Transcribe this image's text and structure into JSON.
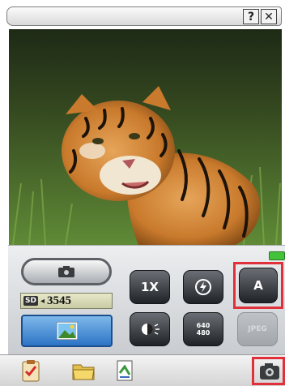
{
  "titlebar": {
    "help_label": "?",
    "close_label": "✕"
  },
  "viewfinder": {
    "subject": "tiger-photo"
  },
  "controls": {
    "sd_label": "SD",
    "counter_arrow": "◂",
    "shots_remaining": "3545",
    "zoom_label": "1X",
    "auto_label": "A",
    "resolution_line1": "640",
    "resolution_line2": "480",
    "format_label": "JPEG"
  },
  "colors": {
    "highlight": "#e0303a",
    "gallery_blue": "#2c74c6",
    "status_led": "#43c23a"
  },
  "icons": [
    "clipboard-icon",
    "folder-icon",
    "document-icon",
    "camera-icon",
    "flash-icon",
    "white-balance-icon"
  ]
}
